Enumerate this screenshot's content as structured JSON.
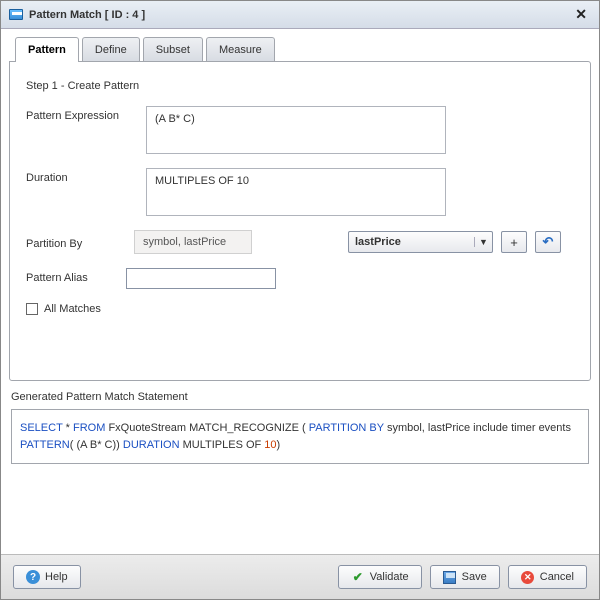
{
  "title": "Pattern Match [ ID : 4 ]",
  "tabs": [
    "Pattern",
    "Define",
    "Subset",
    "Measure"
  ],
  "step_label": "Step 1 - Create Pattern",
  "labels": {
    "pattern_expression": "Pattern Expression",
    "duration": "Duration",
    "partition_by": "Partition By",
    "pattern_alias": "Pattern Alias",
    "all_matches": "All Matches",
    "generated": "Generated Pattern Match Statement"
  },
  "values": {
    "pattern_expression": "(A B* C)",
    "duration": "MULTIPLES OF 10",
    "partition_by_display": "symbol, lastPrice",
    "partition_dropdown": "lastPrice",
    "pattern_alias": "",
    "all_matches_checked": false
  },
  "plus_icon_label": "+",
  "statement": {
    "tokens": [
      {
        "t": "SELECT",
        "c": "kw"
      },
      {
        "t": " * ",
        "c": ""
      },
      {
        "t": "FROM",
        "c": "kw"
      },
      {
        "t": " FxQuoteStream  MATCH_RECOGNIZE ( ",
        "c": ""
      },
      {
        "t": "PARTITION BY",
        "c": "kw"
      },
      {
        "t": " symbol, lastPrice include timer events  ",
        "c": ""
      },
      {
        "t": "PATTERN",
        "c": "kw"
      },
      {
        "t": "( (A B* C)) ",
        "c": ""
      },
      {
        "t": "DURATION",
        "c": "kw"
      },
      {
        "t": " MULTIPLES OF ",
        "c": ""
      },
      {
        "t": "10",
        "c": "num"
      },
      {
        "t": ")",
        "c": ""
      }
    ]
  },
  "buttons": {
    "help": "Help",
    "validate": "Validate",
    "save": "Save",
    "cancel": "Cancel"
  }
}
